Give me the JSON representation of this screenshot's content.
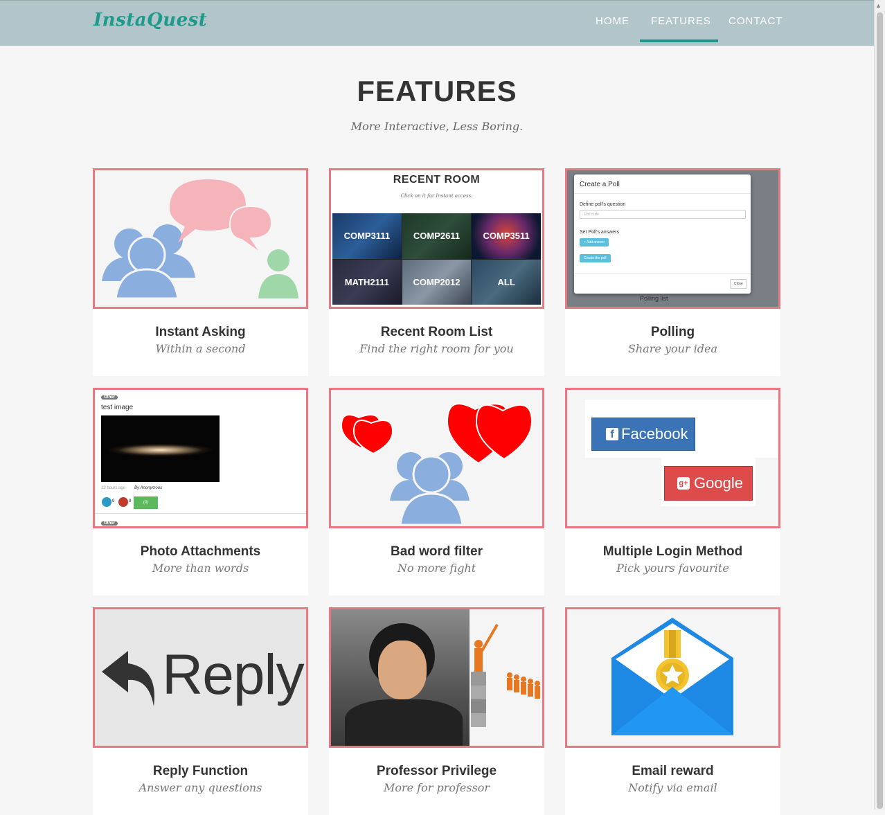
{
  "brand": "InstaQuest",
  "nav": {
    "home": "HOME",
    "features": "FEATURES",
    "contact": "CONTACT",
    "active": "FEATURES"
  },
  "section": {
    "title": "FEATURES",
    "subtitle": "More Interactive, Less Boring."
  },
  "colors": {
    "accent": "#1d9a8a",
    "navbar": "#b2c5cb",
    "thumb_border": "#ea7782"
  },
  "features": [
    {
      "title": "Instant Asking",
      "subtitle": "Within a second"
    },
    {
      "title": "Recent Room List",
      "subtitle": "Find the right room for you"
    },
    {
      "title": "Polling",
      "subtitle": "Share your idea"
    },
    {
      "title": "Photo Attachments",
      "subtitle": "More than words"
    },
    {
      "title": "Bad word filter",
      "subtitle": "No more fight"
    },
    {
      "title": "Multiple Login Method",
      "subtitle": "Pick yours favourite"
    },
    {
      "title": "Reply Function",
      "subtitle": "Answer any questions"
    },
    {
      "title": "Professor Privilege",
      "subtitle": "More for professor"
    },
    {
      "title": "Email reward",
      "subtitle": "Notify via email"
    }
  ],
  "recent_room": {
    "title": "RECENT ROOM",
    "hint": "Click on it for Instant access.",
    "rooms": [
      "COMP3111",
      "COMP2611",
      "COMP3511",
      "MATH2111",
      "COMP2012",
      "ALL"
    ]
  },
  "poll_dialog": {
    "title": "Create a Poll",
    "question_label": "Define poll's question",
    "question_placeholder": "Poll's title",
    "answers_label": "Set Poll's answers",
    "add_answer": "+ Add answer",
    "create": "Create the poll",
    "close": "Close",
    "list_label": "Polling list"
  },
  "photo_post": {
    "tag": "Other",
    "text": "test image",
    "meta": "13 hours ago",
    "author": "By Anonymous",
    "likes": "0",
    "dislikes": "0",
    "comments": "(0)",
    "next_tag": "Other"
  },
  "login": {
    "facebook": "Facebook",
    "google": "Google"
  },
  "reply_label": "Reply"
}
